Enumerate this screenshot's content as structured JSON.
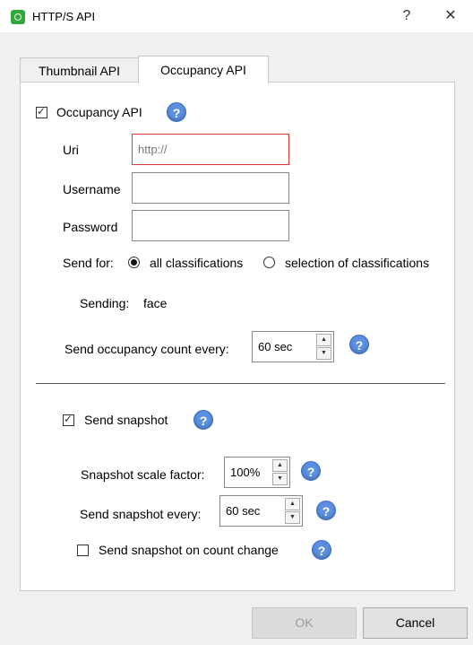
{
  "window": {
    "title": "HTTP/S API",
    "help_btn": "?",
    "close_btn": "✕"
  },
  "tabs": [
    {
      "label": "Thumbnail API",
      "active": false
    },
    {
      "label": "Occupancy API",
      "active": true
    }
  ],
  "occupancy": {
    "enable_label": "Occupancy API",
    "enabled": true,
    "uri_label": "Uri",
    "uri_placeholder": "http://",
    "uri_value": "",
    "username_label": "Username",
    "username_value": "",
    "password_label": "Password",
    "password_value": "",
    "send_for_label": "Send for:",
    "send_for_options": [
      {
        "label": "all classifications",
        "selected": true
      },
      {
        "label": "selection of classifications",
        "selected": false
      }
    ],
    "sending_label": "Sending:",
    "sending_value": "face",
    "count_every_label": "Send occupancy count every:",
    "count_every_value": "60 sec"
  },
  "snapshot": {
    "enable_label": "Send snapshot",
    "enabled": true,
    "scale_label": "Snapshot scale factor:",
    "scale_value": "100%",
    "every_label": "Send snapshot every:",
    "every_value": "60 sec",
    "on_change_label": "Send snapshot on count change",
    "on_change_enabled": false
  },
  "help_glyph": "?",
  "spin_up_glyph": "▲",
  "spin_down_glyph": "▼",
  "footer": {
    "ok_label": "OK",
    "cancel_label": "Cancel"
  },
  "colors": {
    "help_blue": "#5b8fe0",
    "focus_red": "#e03b3b",
    "app_green": "#2eaa3c"
  }
}
